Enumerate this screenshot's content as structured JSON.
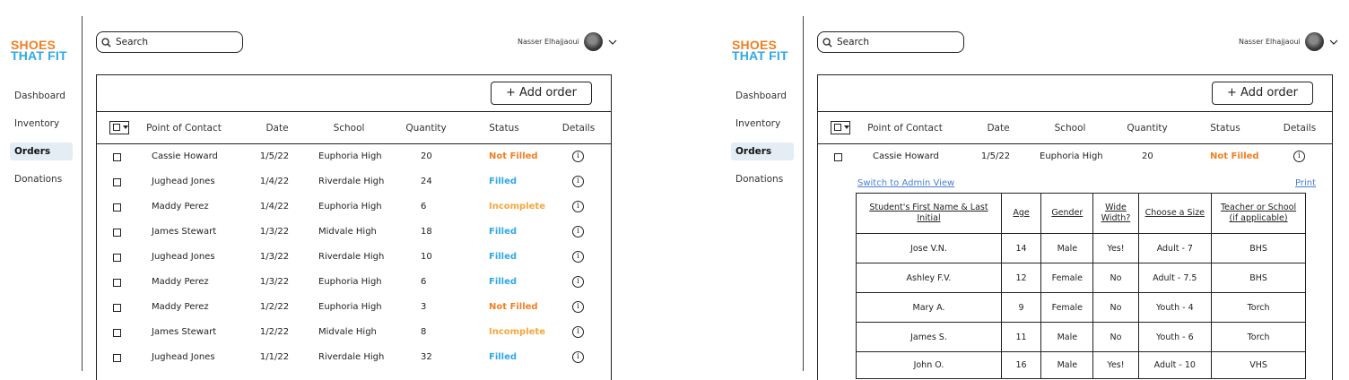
{
  "colors": {
    "not_filled": "#F07F22",
    "filled": "#2FA9E6",
    "incomplete": "#F5A73B",
    "link": "#4A7FD6",
    "active_nav": "#E4ECF4"
  },
  "brand": {
    "line1": "SHOES",
    "line2": "THAT FIT"
  },
  "nav": [
    "Dashboard",
    "Inventory",
    "Orders",
    "Donations"
  ],
  "active_nav": "Orders",
  "search": {
    "placeholder": "Search"
  },
  "user": {
    "name": "Nasser Elhajjaoui"
  },
  "add_order_label": "+ Add order",
  "columns": [
    "Point of Contact",
    "Date",
    "School",
    "Quantity",
    "Status",
    "Details"
  ],
  "orders": [
    {
      "contact": "Cassie Howard",
      "date": "1/5/22",
      "school": "Euphoria High",
      "qty": "20",
      "status": "Not Filled"
    },
    {
      "contact": "Jughead Jones",
      "date": "1/4/22",
      "school": "Riverdale High",
      "qty": "24",
      "status": "Filled"
    },
    {
      "contact": "Maddy Perez",
      "date": "1/4/22",
      "school": "Euphoria High",
      "qty": "6",
      "status": "Incomplete"
    },
    {
      "contact": "James Stewart",
      "date": "1/3/22",
      "school": "Midvale High",
      "qty": "18",
      "status": "Filled"
    },
    {
      "contact": "Jughead Jones",
      "date": "1/3/22",
      "school": "Riverdale High",
      "qty": "10",
      "status": "Filled"
    },
    {
      "contact": "Maddy Perez",
      "date": "1/3/22",
      "school": "Euphoria High",
      "qty": "6",
      "status": "Filled"
    },
    {
      "contact": "Maddy Perez",
      "date": "1/2/22",
      "school": "Euphoria High",
      "qty": "3",
      "status": "Not Filled"
    },
    {
      "contact": "James Stewart",
      "date": "1/2/22",
      "school": "Midvale High",
      "qty": "8",
      "status": "Incomplete"
    },
    {
      "contact": "Jughead Jones",
      "date": "1/1/22",
      "school": "Riverdale High",
      "qty": "32",
      "status": "Filled"
    }
  ],
  "detail": {
    "order": {
      "contact": "Cassie Howard",
      "date": "1/5/22",
      "school": "Euphoria High",
      "qty": "20",
      "status": "Not Filled"
    },
    "switch_link": "Switch to Admin View",
    "print_link": "Print",
    "headers": [
      "Student's First Name & Last Initial",
      "Age",
      "Gender",
      "Wide Width?",
      "Choose a Size",
      "Teacher or School (if applicable)"
    ],
    "students": [
      [
        "Jose V.N.",
        "14",
        "Male",
        "Yes!",
        "Adult - 7",
        "BHS"
      ],
      [
        "Ashley F.V.",
        "12",
        "Female",
        "No",
        "Adult - 7.5",
        "BHS"
      ],
      [
        "Mary A.",
        "9",
        "Female",
        "No",
        "Youth - 4",
        "Torch"
      ],
      [
        "James S.",
        "11",
        "Male",
        "No",
        "Youth - 6",
        "Torch"
      ],
      [
        "John O.",
        "16",
        "Male",
        "Yes!",
        "Adult - 10",
        "VHS"
      ]
    ]
  }
}
